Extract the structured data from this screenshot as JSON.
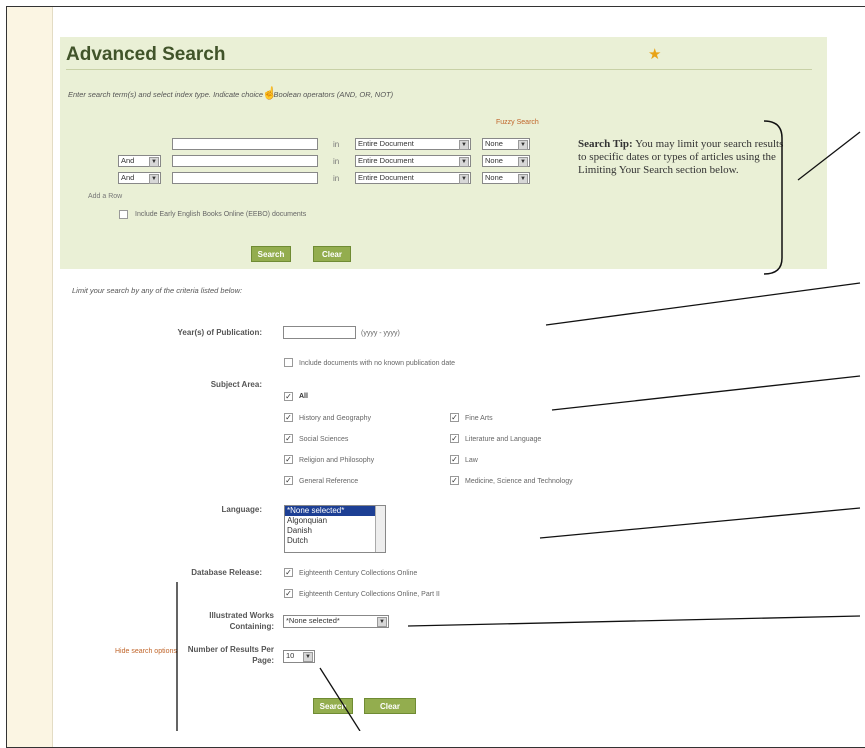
{
  "header": {
    "title": "Advanced Search",
    "star_icon": "star-icon"
  },
  "instructions": "Enter search term(s) and select index type. Indicate choice of Boolean operators (AND, OR, NOT)",
  "fuzzy_search": "Fuzzy Search",
  "search_rows": [
    {
      "operator": "",
      "in_label": "in",
      "index": "Entire Document",
      "fuzzy": "None"
    },
    {
      "operator": "And",
      "in_label": "in",
      "index": "Entire Document",
      "fuzzy": "None"
    },
    {
      "operator": "And",
      "in_label": "in",
      "index": "Entire Document",
      "fuzzy": "None"
    }
  ],
  "add_row": "Add a Row",
  "eebo_checkbox": "Include Early English Books Online (EEBO) documents",
  "search_tip": {
    "label": "Search Tip:",
    "text": "You may limit your search results to specific dates or types of articles using the Limiting Your Search section below."
  },
  "buttons": {
    "search": "Search",
    "clear": "Clear"
  },
  "limit_text": "Limit your search by any of the criteria listed below:",
  "year": {
    "label": "Year(s) of Publication:",
    "placeholder": "(yyyy - yyyy)",
    "include_unknown": "Include documents with no known publication date"
  },
  "subject": {
    "label": "Subject Area:",
    "all": "All",
    "left": [
      "History and Geography",
      "Social Sciences",
      "Religion and Philosophy",
      "General Reference"
    ],
    "right": [
      "Fine Arts",
      "Literature and Language",
      "Law",
      "Medicine, Science and Technology"
    ]
  },
  "language": {
    "label": "Language:",
    "options": [
      "*None selected*",
      "Algonquian",
      "Danish",
      "Dutch"
    ]
  },
  "database": {
    "label": "Database Release:",
    "options": [
      "Eighteenth Century Collections Online",
      "Eighteenth Century Collections Online, Part II"
    ]
  },
  "illustrated": {
    "label_line1": "Illustrated Works",
    "label_line2": "Containing:",
    "value": "*None selected*"
  },
  "results": {
    "label_line1": "Number of Results Per",
    "label_line2": "Page:",
    "value": "10"
  },
  "hide_options": "Hide search options",
  "colors": {
    "accent_green": "#93ad4e",
    "panel_bg": "#eaf0d6",
    "link_orange": "#c0652a",
    "title": "#41542a"
  }
}
